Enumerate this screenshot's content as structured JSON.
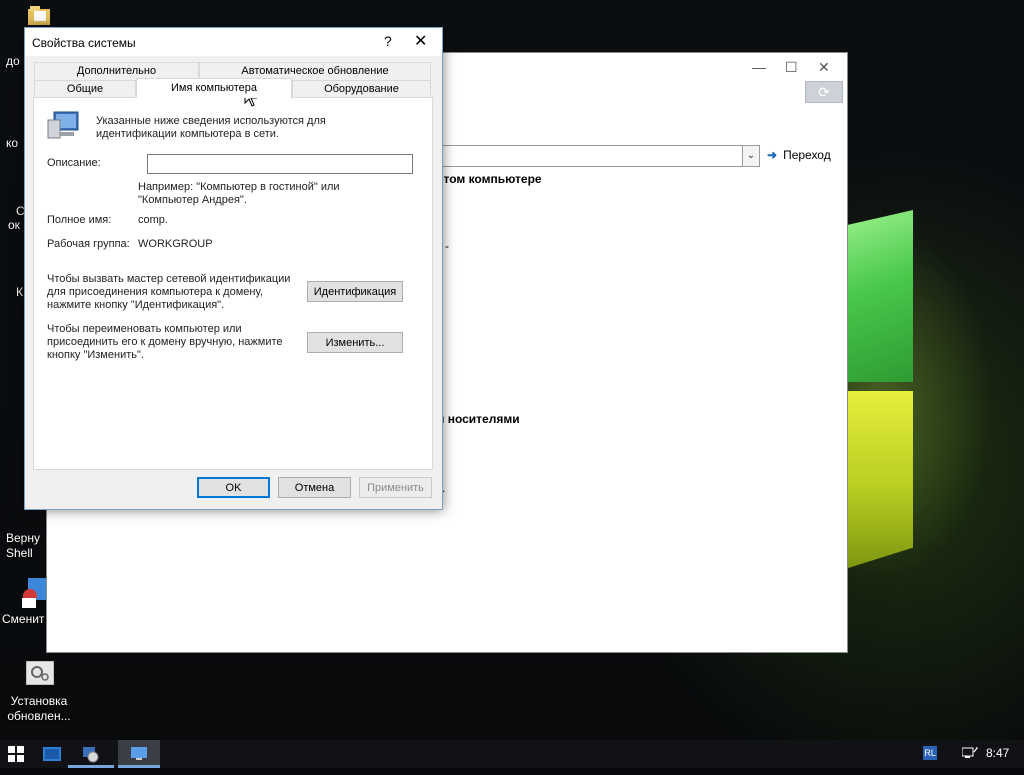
{
  "desktop": {
    "icons": [
      {
        "label": "до"
      },
      {
        "label": "ко"
      },
      {
        "label": "С"
      },
      {
        "label": "ок"
      },
      {
        "label": "К"
      },
      {
        "label": "Верну\nShell"
      },
      {
        "label": "Сменит"
      },
      {
        "label": "Установка\nобновлен..."
      }
    ]
  },
  "explorer": {
    "go_label": "Переход",
    "text_1": "этом компьютере",
    "text_2": "-",
    "text_3": "и носителями",
    "text_4": "."
  },
  "dialog": {
    "title": "Свойства системы",
    "help": "?",
    "close": "✕",
    "tabs_top": [
      {
        "label": "Дополнительно"
      },
      {
        "label": "Автоматическое обновление"
      }
    ],
    "tabs_bottom": [
      {
        "label": "Общие"
      },
      {
        "label": "Имя компьютера",
        "active": true
      },
      {
        "label": "Оборудование"
      }
    ],
    "intro": "Указанные ниже сведения используются для идентификации компьютера в сети.",
    "description_label": "Описание:",
    "description_value": "",
    "example_text": "Например: \"Компьютер в гостиной\" или \"Компьютер Андрея\".",
    "fullname_label": "Полное имя:",
    "fullname_value": "comp.",
    "workgroup_label": "Рабочая группа:",
    "workgroup_value": "WORKGROUP",
    "wizard_text": "Чтобы вызвать мастер сетевой идентификации для присоединения компьютера к домену, нажмите кнопку \"Идентификация\".",
    "wizard_button": "Идентификация",
    "rename_text": "Чтобы переименовать компьютер или присоединить его к домену вручную, нажмите кнопку \"Изменить\".",
    "rename_button": "Изменить...",
    "ok": "OK",
    "cancel": "Отмена",
    "apply": "Применить"
  },
  "taskbar": {
    "lang": "RL",
    "time": "8:47"
  }
}
